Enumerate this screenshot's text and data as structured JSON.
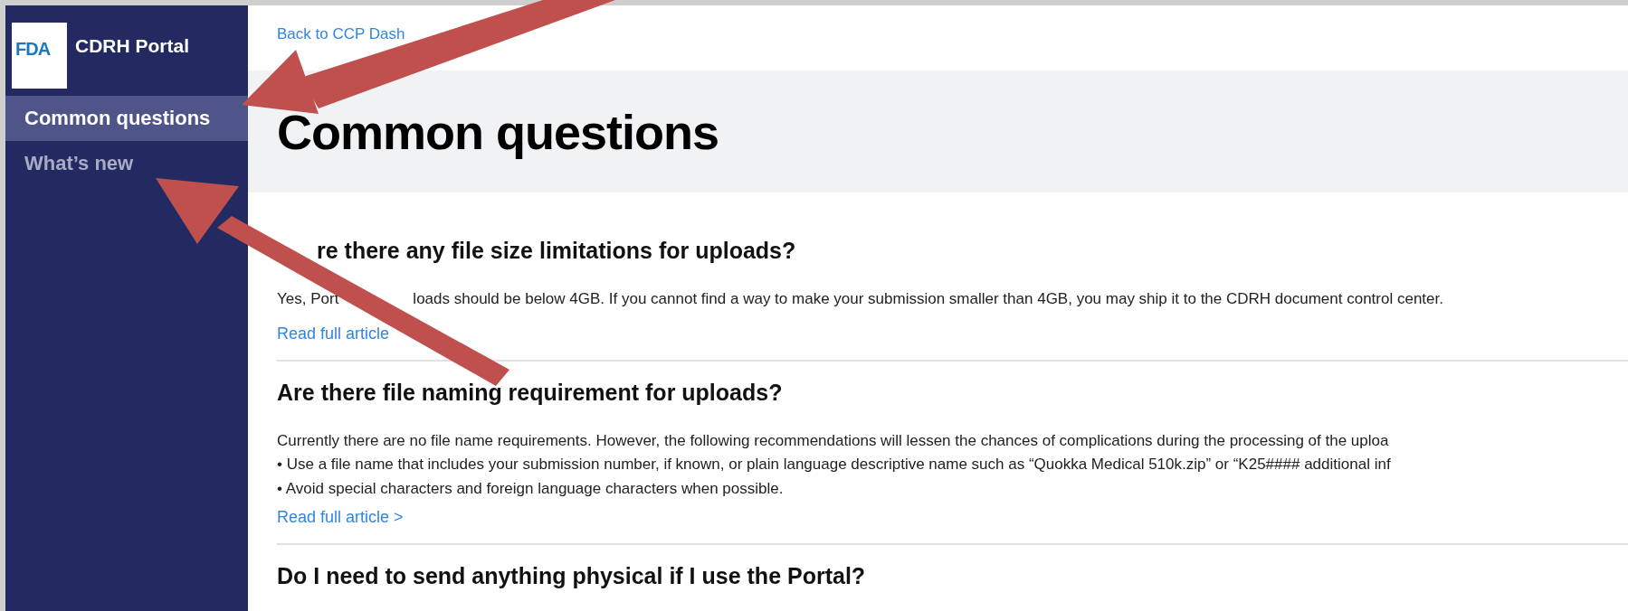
{
  "sidebar": {
    "logo": "FDA",
    "title": "CDRH Portal",
    "items": [
      {
        "label": "Common questions",
        "selected": true
      },
      {
        "label": "What’s new",
        "selected": false
      }
    ]
  },
  "back_link": "Back to CCP Dash",
  "page_title": "Common questions",
  "faqs": [
    {
      "question": "re there any file size limitations for uploads?",
      "lead_hidden": true,
      "lines": [
        [
          "Yes, Port",
          "loads should be below 4GB. If you cannot find a way to make your submission smaller than 4GB, you may ship it to the CDRH document control center."
        ]
      ],
      "link": "Read full article"
    },
    {
      "question": "Are there file naming requirement for uploads?",
      "lead_hidden": false,
      "lines": [
        [
          "Currently there are no file name requirements. However, the following recommendations will lessen the chances of complications during the processing of the uploa"
        ],
        [
          "• Use a file name that includes your submission number, if known, or plain language descriptive name such as “Quokka Medical 510k.zip” or “K25#### additional inf"
        ],
        [
          "• Avoid special characters and foreign language characters when possible."
        ]
      ],
      "link": "Read full article >"
    },
    {
      "question": "Do I need to send anything physical if I use the Portal?"
    }
  ]
}
